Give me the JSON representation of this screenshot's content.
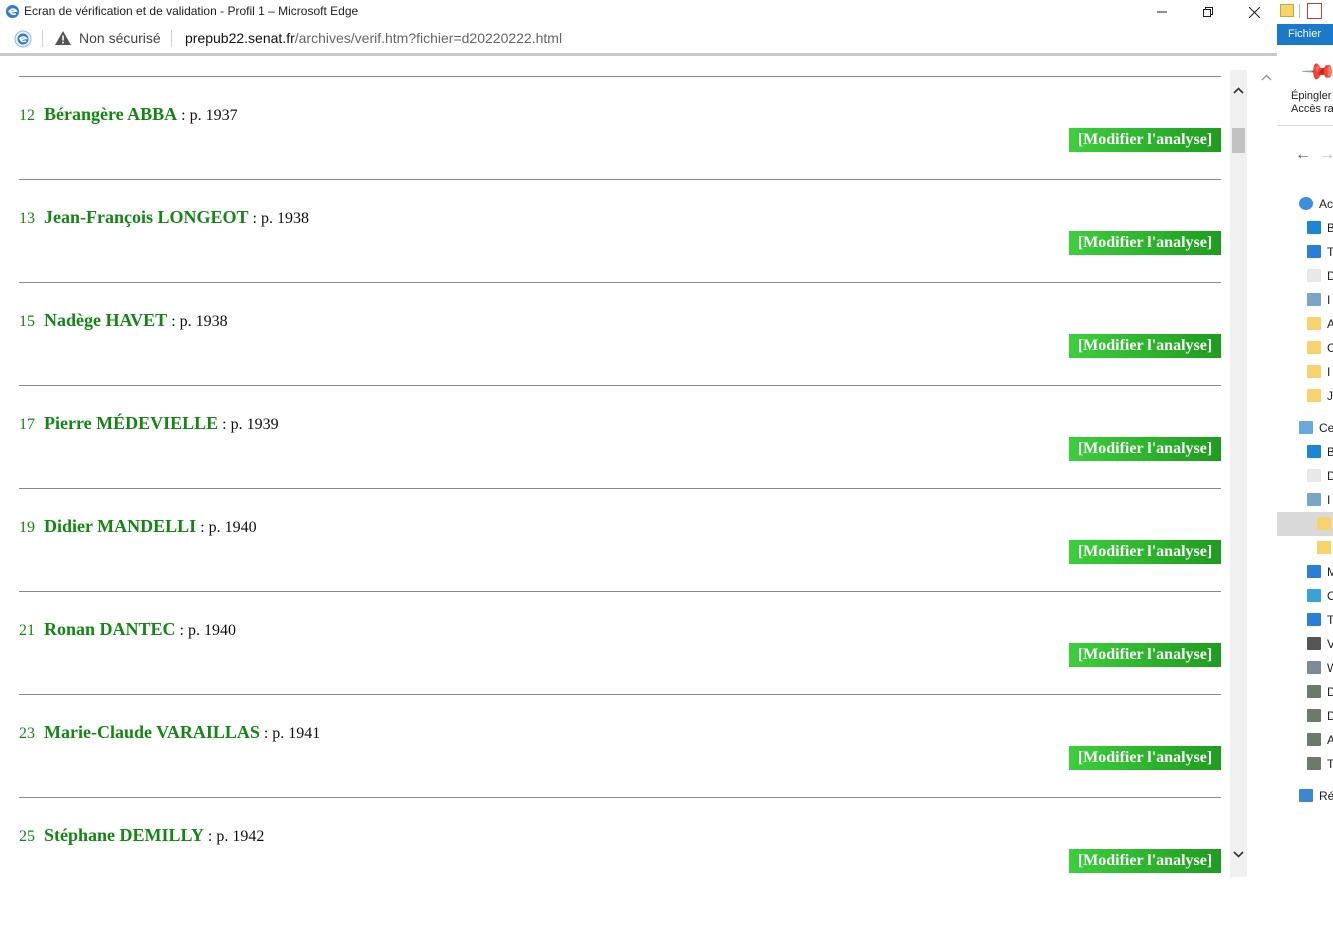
{
  "window": {
    "title": "Ecran de vérification et de validation - Profil 1 – Microsoft Edge",
    "minimize": "—",
    "maximize": "❐",
    "close": "✕"
  },
  "address": {
    "security_label": "Non sécurisé",
    "url_domain": "prepub22.senat.fr",
    "url_path": "/archives/verif.htm?fichier=d20220222.html"
  },
  "entries": [
    {
      "num": "12",
      "name": "Bérangère ABBA",
      "page": " : p. 1937",
      "button": "[Modifier l'analyse]"
    },
    {
      "num": "13",
      "name": "Jean-François LONGEOT",
      "page": " : p. 1938",
      "button": "[Modifier l'analyse]"
    },
    {
      "num": "15",
      "name": "Nadège HAVET",
      "page": " : p. 1938",
      "button": "[Modifier l'analyse]"
    },
    {
      "num": "17",
      "name": "Pierre MÉDEVIELLE",
      "page": " : p. 1939",
      "button": "[Modifier l'analyse]"
    },
    {
      "num": "19",
      "name": "Didier MANDELLI",
      "page": " : p. 1940",
      "button": "[Modifier l'analyse]"
    },
    {
      "num": "21",
      "name": "Ronan DANTEC",
      "page": " : p. 1940",
      "button": "[Modifier l'analyse]"
    },
    {
      "num": "23",
      "name": "Marie-Claude VARAILLAS",
      "page": " : p. 1941",
      "button": "[Modifier l'analyse]"
    },
    {
      "num": "25",
      "name": "Stéphane DEMILLY",
      "page": " : p. 1942",
      "button": "[Modifier l'analyse]"
    }
  ],
  "explorer": {
    "menu_file": "Fichier",
    "pin_label_1": "Épingler",
    "pin_label_2": "Accès rap",
    "tree": [
      {
        "label": "Ac",
        "icon": "quick-access-star-icon"
      },
      {
        "label": "B",
        "icon": "desktop-icon"
      },
      {
        "label": "T",
        "icon": "download-icon"
      },
      {
        "label": "D",
        "icon": "document-icon"
      },
      {
        "label": "I",
        "icon": "pictures-icon"
      },
      {
        "label": "A",
        "icon": "folder-icon"
      },
      {
        "label": "C",
        "icon": "folder-icon"
      },
      {
        "label": "I",
        "icon": "folder-icon"
      },
      {
        "label": "J",
        "icon": "folder-icon"
      },
      {
        "label": "Ce",
        "icon": "computer-icon"
      },
      {
        "label": "B",
        "icon": "desktop-icon"
      },
      {
        "label": "D",
        "icon": "document-icon"
      },
      {
        "label": "I",
        "icon": "pictures-icon"
      },
      {
        "label": "",
        "icon": "folder-icon"
      },
      {
        "label": "",
        "icon": "folder-icon"
      },
      {
        "label": "M",
        "icon": "music-icon"
      },
      {
        "label": "O",
        "icon": "3d-objects-icon"
      },
      {
        "label": "T",
        "icon": "download-icon"
      },
      {
        "label": "V",
        "icon": "video-icon"
      },
      {
        "label": "W",
        "icon": "drive-icon"
      },
      {
        "label": "D",
        "icon": "network-drive-icon"
      },
      {
        "label": "D",
        "icon": "network-drive-icon"
      },
      {
        "label": "A",
        "icon": "network-drive-icon"
      },
      {
        "label": "T",
        "icon": "network-drive-icon"
      },
      {
        "label": "Ré",
        "icon": "network-icon"
      }
    ]
  },
  "colors": {
    "name_green": "#118811",
    "button_green": "#2fbf2f",
    "explorer_blue": "#1979ca"
  }
}
